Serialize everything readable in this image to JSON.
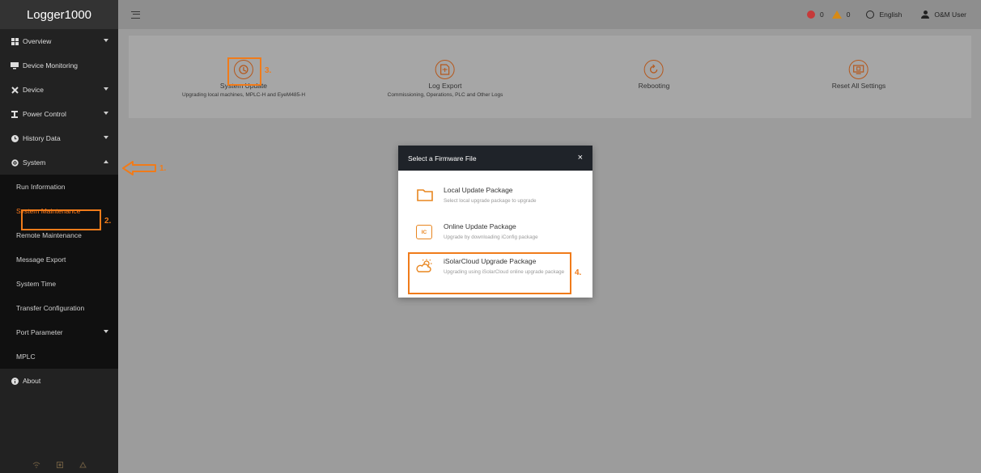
{
  "app": {
    "title": "Logger1000"
  },
  "topbar": {
    "error_count": "0",
    "warning_count": "0",
    "language": "English",
    "user": "O&M User"
  },
  "sidebar": {
    "items": [
      {
        "label": "Overview",
        "icon": "grid-icon",
        "expandable": true
      },
      {
        "label": "Device Monitoring",
        "icon": "monitor-icon",
        "expandable": false
      },
      {
        "label": "Device",
        "icon": "tools-icon",
        "expandable": true
      },
      {
        "label": "Power Control",
        "icon": "power-control-icon",
        "expandable": true
      },
      {
        "label": "History Data",
        "icon": "clock-icon",
        "expandable": true
      },
      {
        "label": "System",
        "icon": "gear-icon",
        "expandable": true,
        "expanded": true
      }
    ],
    "system_submenu": [
      {
        "label": "Run Information"
      },
      {
        "label": "System Maintenance",
        "active": true
      },
      {
        "label": "Remote Maintenance"
      },
      {
        "label": "Message Export"
      },
      {
        "label": "System Time"
      },
      {
        "label": "Transfer Configuration"
      },
      {
        "label": "Port Parameter",
        "expandable": true
      },
      {
        "label": "MPLC"
      }
    ],
    "about": {
      "label": "About"
    }
  },
  "functions": [
    {
      "title": "System Update",
      "desc": "Upgrading local machines, MPLC-H and EyeM485-H"
    },
    {
      "title": "Log Export",
      "desc": "Commissioning, Operations, PLC and Other Logs"
    },
    {
      "title": "Rebooting",
      "desc": ""
    },
    {
      "title": "Reset All Settings",
      "desc": ""
    }
  ],
  "modal": {
    "title": "Select a Firmware File",
    "close": "×",
    "options": [
      {
        "title": "Local Update Package",
        "desc": "Select local upgrade package to upgrade",
        "icon": "folder-icon"
      },
      {
        "title": "Online Update Package",
        "desc": "Upgrade by downloading iConfig package",
        "icon": "iconfig-icon",
        "icon_text": "IC"
      },
      {
        "title": "iSolarCloud Upgrade Package",
        "desc": "Upgrading using iSolarCloud online upgrade package",
        "icon": "cloud-sun-icon"
      }
    ]
  },
  "annotations": {
    "step1": "1.",
    "step2": "2.",
    "step3": "3.",
    "step4": "4."
  },
  "colors": {
    "accent": "#f07b1a",
    "sidebar_bg": "#222222",
    "header_dark": "#1f2329"
  }
}
